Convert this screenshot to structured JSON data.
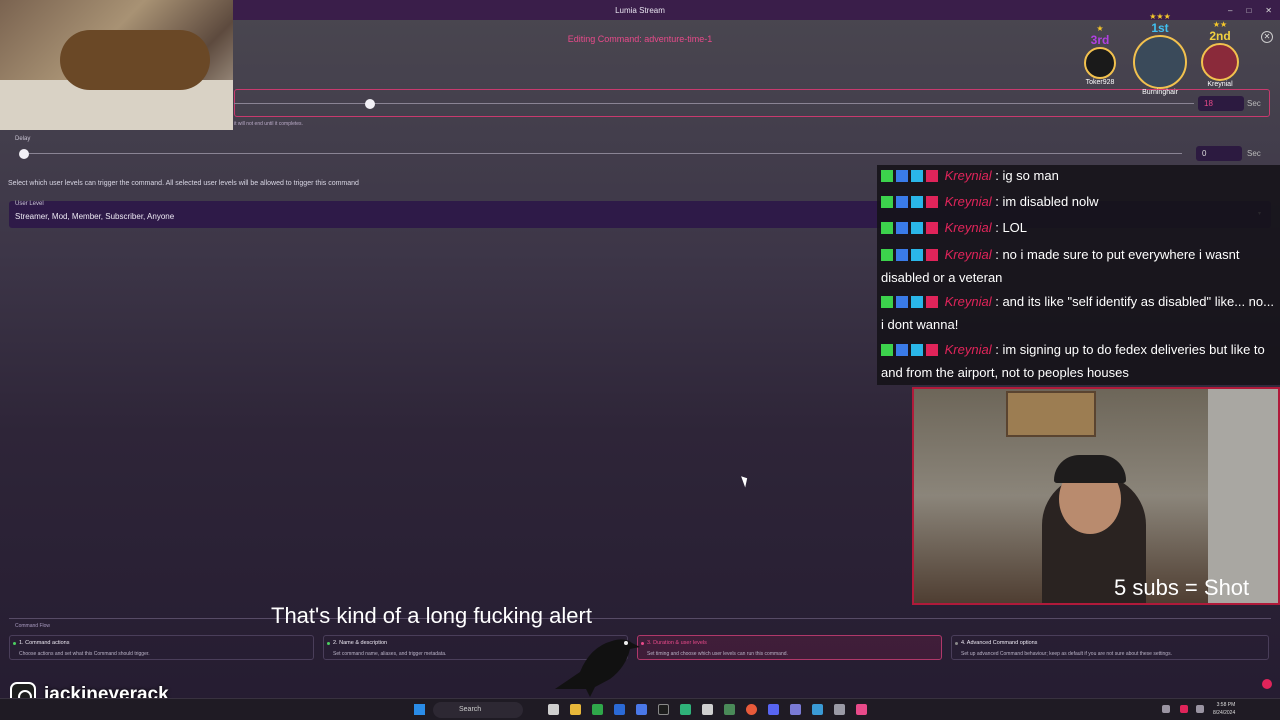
{
  "window": {
    "title": "Lumia Stream",
    "controls": [
      "–",
      "□",
      "✕"
    ]
  },
  "editor": {
    "editing_title": "Editing Command: adventure-time-1",
    "close_label": "✕",
    "timer": {
      "helper": "it will not end until it completes.",
      "value": "18",
      "unit": "Sec",
      "level_fraction": 0.1
    },
    "delay": {
      "label": "Delay",
      "value": "0",
      "unit": "Sec",
      "level_fraction": 0.0
    },
    "user_levels_help": "Select which user levels can trigger the command. All selected user levels will be allowed to trigger this command",
    "user_level": {
      "label": "User Level",
      "value": "Streamer, Mod, Member, Subscriber, Anyone",
      "caret": "▾"
    }
  },
  "command_flow": {
    "title": "Command Flow",
    "steps": [
      {
        "title": "1. Command actions",
        "desc": "Choose actions and set what this Command should trigger."
      },
      {
        "title": "2. Name & description",
        "desc": "Set command name, aliases, and trigger metadata."
      },
      {
        "title": "3. Duration & user levels",
        "desc": "Set timing and choose which user levels can run this command."
      },
      {
        "title": "4. Advanced Command options",
        "desc": "Set up advanced Command behaviour; keep as default if you are not sure about these settings."
      }
    ]
  },
  "leaderboard": [
    {
      "rank": "3rd",
      "stars": "★",
      "name": "Toker928",
      "color": "#b040e0"
    },
    {
      "rank": "1st",
      "stars": "★★★",
      "name": "Burninghair",
      "color": "#40c0f0"
    },
    {
      "rank": "2nd",
      "stars": "★★",
      "name": "Kreynial",
      "color": "#f0d040"
    }
  ],
  "chat": [
    {
      "user": "Kreynial",
      "text": "ig so man"
    },
    {
      "user": "Kreynial",
      "text": "im disabled nolw"
    },
    {
      "user": "Kreynial",
      "text": "LOL"
    },
    {
      "user": "Kreynial",
      "text": "no i made sure to put everywhere i wasnt disabled or a veteran"
    },
    {
      "user": "Kreynial",
      "text": "and its like \"self identify as disabled\" like... no... i dont wanna!"
    },
    {
      "user": "Kreynial",
      "text": "im signing up to do fedex deliveries but like to and from the airport, not to peoples houses"
    }
  ],
  "stream": {
    "caption": "That's kind of a long fucking alert",
    "sub_goal": "5 subs = Shot",
    "instagram": "jackineyerack"
  },
  "taskbar": {
    "search": "Search",
    "time": "3:58 PM",
    "date": "8/24/2024"
  },
  "colors": {
    "accent": "#e84a8a",
    "chat_user": "#e0245a",
    "frame": "#b01a3a"
  }
}
